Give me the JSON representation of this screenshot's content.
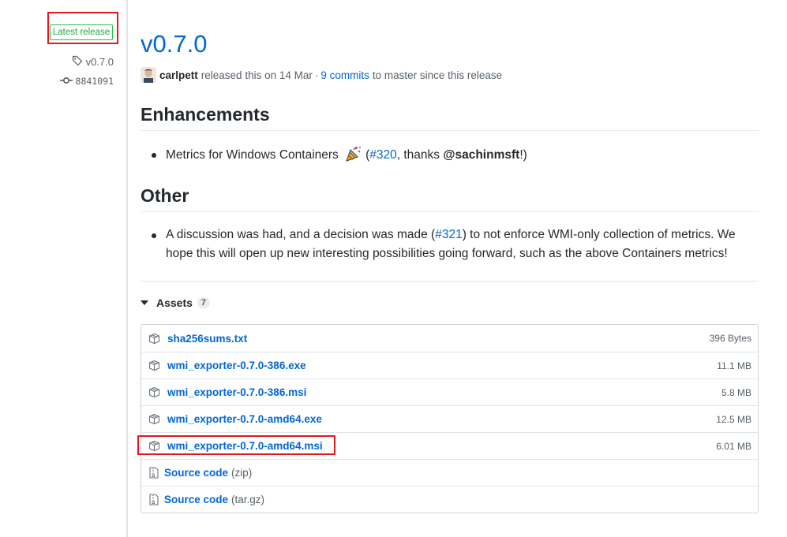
{
  "sidebar": {
    "latest_badge": "Latest release",
    "tag": "v0.7.0",
    "commit": "8841091"
  },
  "release": {
    "title": "v0.7.0",
    "author": "carlpett",
    "released_text": "released this on 14 Mar",
    "separator": "·",
    "commits_link": "9 commits",
    "commits_suffix": "to master since this release"
  },
  "notes": {
    "enhancements_heading": "Enhancements",
    "enhancement_item": {
      "text": "Metrics for Windows Containers",
      "open": "(",
      "issue": "#320",
      "thanks": ", thanks",
      "user": "@sachinmsft",
      "close": "!)"
    },
    "other_heading": "Other",
    "other_item": {
      "pre": "A discussion was had, and a decision was made (",
      "issue": "#321",
      "post": ") to not enforce WMI-only collection of metrics. We hope this will open up new interesting possibilities going forward, such as the above Containers metrics!"
    }
  },
  "assets": {
    "label": "Assets",
    "count": "7",
    "files": [
      {
        "name": "sha256sums.txt",
        "size": "396 Bytes"
      },
      {
        "name": "wmi_exporter-0.7.0-386.exe",
        "size": "11.1 MB"
      },
      {
        "name": "wmi_exporter-0.7.0-386.msi",
        "size": "5.8 MB"
      },
      {
        "name": "wmi_exporter-0.7.0-amd64.exe",
        "size": "12.5 MB"
      },
      {
        "name": "wmi_exporter-0.7.0-amd64.msi",
        "size": "6.01 MB"
      }
    ],
    "source": [
      {
        "name": "Source code",
        "suffix": "(zip)"
      },
      {
        "name": "Source code",
        "suffix": "(tar.gz)"
      }
    ]
  },
  "colors": {
    "link": "#0366d6",
    "badge_green": "#28a745",
    "highlight_red": "#e1191f"
  },
  "icons": {
    "tag": "tag-icon",
    "commit": "git-commit-icon",
    "package": "package-icon",
    "zip": "file-zip-icon",
    "party": "party-popper-emoji"
  }
}
